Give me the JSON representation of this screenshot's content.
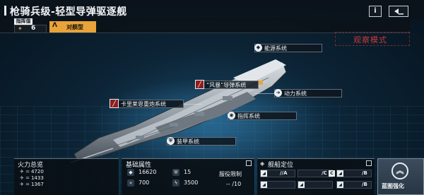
{
  "header": {
    "title": "枪骑兵级-轻型导弹驱逐舰",
    "info_icon": "i",
    "back_icon": "back-arrow-icon",
    "command_label": "指挥值",
    "command_value": "6",
    "class_label": "对舰型",
    "observe_mode": "观察模式"
  },
  "systems": {
    "energy": "能源系统",
    "storm_missile": "“风暴”导弹系统",
    "power": "动力系统",
    "heavy_cannon": "卡里莱恩重炮系统",
    "command": "指挥系统",
    "armor": "装甲系统"
  },
  "firepower": {
    "title": "火力总览",
    "rows": [
      "4720",
      "1433",
      "1367"
    ]
  },
  "attributes": {
    "title": "基础属性",
    "hp": "16620",
    "armor": "15",
    "speed": "700",
    "energy": "3500",
    "deploy_limit_label": "服役限制",
    "deploy_limit_value": "-- /10"
  },
  "positioning": {
    "title": "舰船定位",
    "cells": [
      "//A",
      "/C",
      "/B",
      "/B"
    ]
  },
  "blueprint": {
    "label": "蓝图强化"
  },
  "colors": {
    "accent": "#e8a33a",
    "alert": "#c93a3a",
    "missile_icon": "#8d1f1f"
  }
}
